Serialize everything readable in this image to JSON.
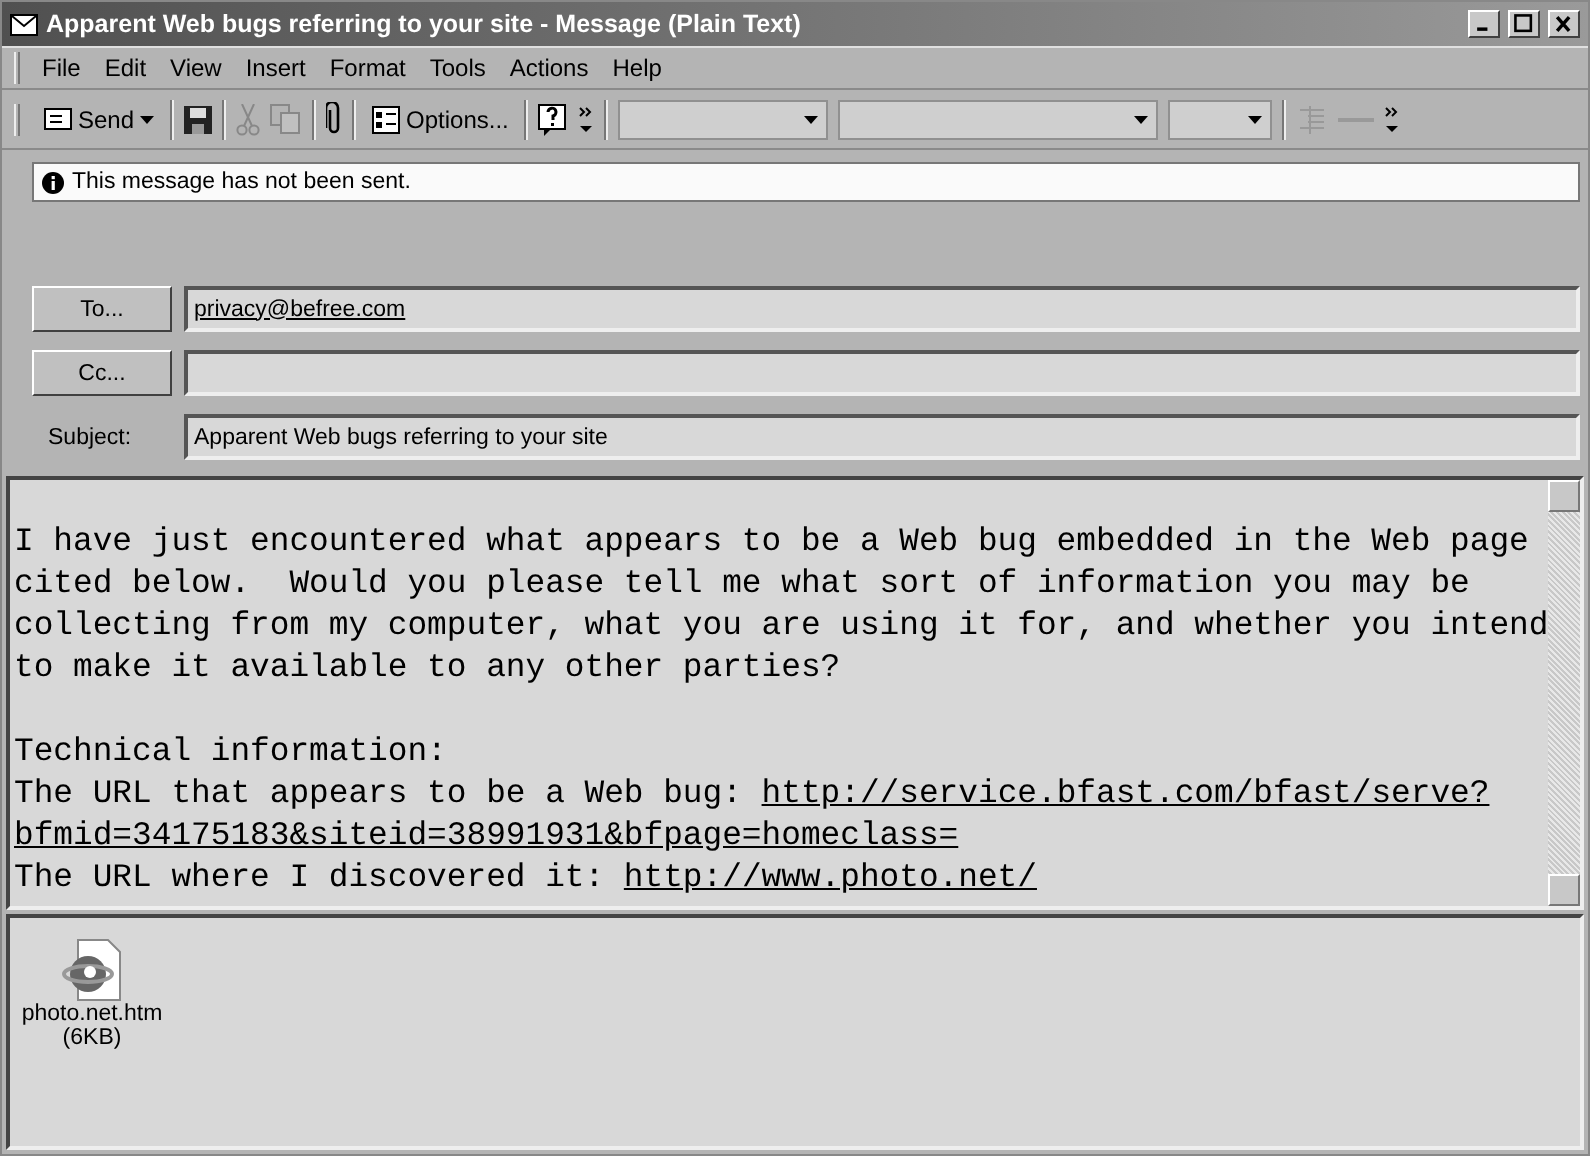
{
  "window": {
    "title": "Apparent Web bugs referring to your site - Message (Plain Text)"
  },
  "menu": [
    "File",
    "Edit",
    "View",
    "Insert",
    "Format",
    "Tools",
    "Actions",
    "Help"
  ],
  "toolbar": {
    "send": "Send",
    "options": "Options..."
  },
  "info": "This message has not been sent.",
  "fields": [
    {
      "kind": "button",
      "label": "To...",
      "value": "privacy@befree.com"
    },
    {
      "kind": "button",
      "label": "Cc..."
    },
    {
      "kind": "label",
      "label": "Subject:",
      "value": "Apparent Web bugs referring to your site"
    }
  ],
  "body": {
    "paragraph": "I have just encountered what appears to be a Web bug embedded in the Web page\ncited below.  Would you please tell me what sort of information you may be\ncollecting from my computer, what you are using it for, and whether you intend\nto make it available to any other parties?",
    "lines": [
      {
        "text": "Technical information:"
      },
      {
        "text": "The URL that appears to be a Web bug: ",
        "link": "http://service.bfast.com/bfast/serve?"
      },
      {
        "link": "bfmid=34175183&siteid=38991931&bfpage=homeclass="
      },
      {
        "text": "The URL where I discovered it: ",
        "link": "http://www.photo.net/"
      }
    ]
  },
  "attachment": {
    "name": "photo.net.htm",
    "size": "(6KB)"
  }
}
